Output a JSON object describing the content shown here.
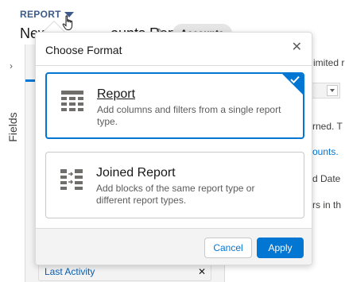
{
  "header": {
    "object_label": "REPORT",
    "report_name_left": "New",
    "report_name_right": "ounts Report",
    "report_type_pill": "Accounts"
  },
  "left_rail": {
    "label": "Fields",
    "chevron": "›"
  },
  "background": {
    "limited_text": "imited r",
    "column_header": "y",
    "texts": [
      "rned. T",
      "ounts.",
      "d Date",
      "rs in th"
    ],
    "last_activity_label": "Last Activity",
    "last_activity_remove": "✕"
  },
  "modal": {
    "title": "Choose Format",
    "close_glyph": "✕",
    "options": [
      {
        "title": "Report",
        "description": "Add columns and filters from a single report type.",
        "icon": "tabular-report-icon",
        "selected": true
      },
      {
        "title": "Joined Report",
        "description": "Add blocks of the same report type or different report types.",
        "icon": "joined-report-icon",
        "selected": false
      }
    ],
    "cancel_label": "Cancel",
    "apply_label": "Apply"
  },
  "colors": {
    "brand_blue": "#0176d3",
    "header_label": "#3c5a8a",
    "border": "#dddbda",
    "icon_gray": "#706e6b"
  }
}
